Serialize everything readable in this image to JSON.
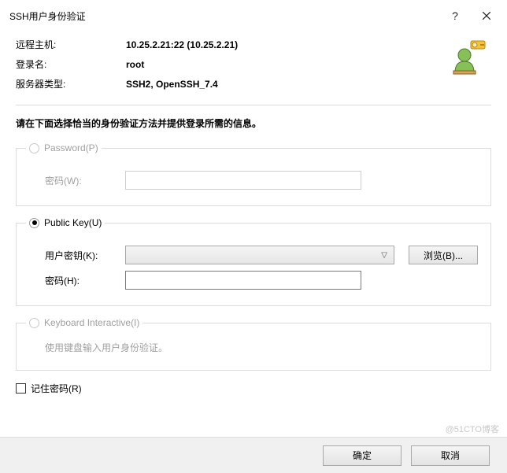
{
  "titlebar": {
    "title": "SSH用户身份验证"
  },
  "info": {
    "remote_host_label": "远程主机:",
    "remote_host_value": "10.25.2.21:22 (10.25.2.21)",
    "login_label": "登录名:",
    "login_value": "root",
    "server_type_label": "服务器类型:",
    "server_type_value": "SSH2, OpenSSH_7.4"
  },
  "instruction": "请在下面选择恰当的身份验证方法并提供登录所需的信息。",
  "password_group": {
    "title": "Password(P)",
    "password_label": "密码(W):"
  },
  "publickey_group": {
    "title": "Public Key(U)",
    "userkey_label": "用户密钥(K):",
    "browse_label": "浏览(B)...",
    "password_label": "密码(H):"
  },
  "ki_group": {
    "title": "Keyboard Interactive(I)",
    "hint": "使用键盘输入用户身份验证。"
  },
  "remember_label": "记住密码(R)",
  "buttons": {
    "ok": "确定",
    "cancel": "取消"
  },
  "watermark": "@51CTO博客"
}
